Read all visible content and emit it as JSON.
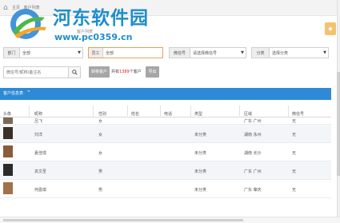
{
  "breadcrumb": [
    "主页",
    "客户列表"
  ],
  "watermark": {
    "title": "河东软件园",
    "url": "www.pc0359.cn",
    "subtitle": "客户列表"
  },
  "filters": {
    "dept_label": "部门",
    "dept_value": "全部",
    "staff_label": "员工",
    "staff_value": "全部",
    "wechat_label": "微信号",
    "wechat_value": "请选择微信号",
    "category_label": "分类",
    "category_value": "选择分类",
    "search_placeholder": "微信号/昵称/备注名",
    "transfer_button": "转移客户",
    "count_prefix": "共有",
    "count_value": "1389",
    "count_suffix": "个客户",
    "export_button": "导出"
  },
  "panel": {
    "title": "客户信息表",
    "chevron": "⌃"
  },
  "table": {
    "headers": [
      "头像",
      "昵称",
      "性别",
      "姓名",
      "电话",
      "类型",
      "区域",
      "微信号"
    ],
    "rows": [
      {
        "nickname": "吕飞",
        "gender": "女",
        "name": "",
        "phone": "",
        "type": "",
        "region": "广东 广州",
        "wechat": "无"
      },
      {
        "nickname": "刘洋",
        "gender": "女",
        "name": "",
        "phone": "",
        "type": "未分类",
        "region": "湖南 永州",
        "wechat": "无"
      },
      {
        "nickname": "夏佳璟",
        "gender": "女",
        "name": "",
        "phone": "",
        "type": "未分类",
        "region": "湖南 长沙",
        "wechat": "无"
      },
      {
        "nickname": "袁文圣",
        "gender": "男",
        "name": "",
        "phone": "",
        "type": "未分类",
        "region": "广东 广州",
        "wechat": "无"
      },
      {
        "nickname": "何嘉琪",
        "gender": "男",
        "name": "",
        "phone": "",
        "type": "未分类",
        "region": "广东 肇庆",
        "wechat": "无"
      }
    ]
  },
  "colors": {
    "accent": "#2f8ad6",
    "watermark": "#1e8ec9",
    "count_highlight": "#e0261a",
    "corner_button": "#f4c26f"
  }
}
